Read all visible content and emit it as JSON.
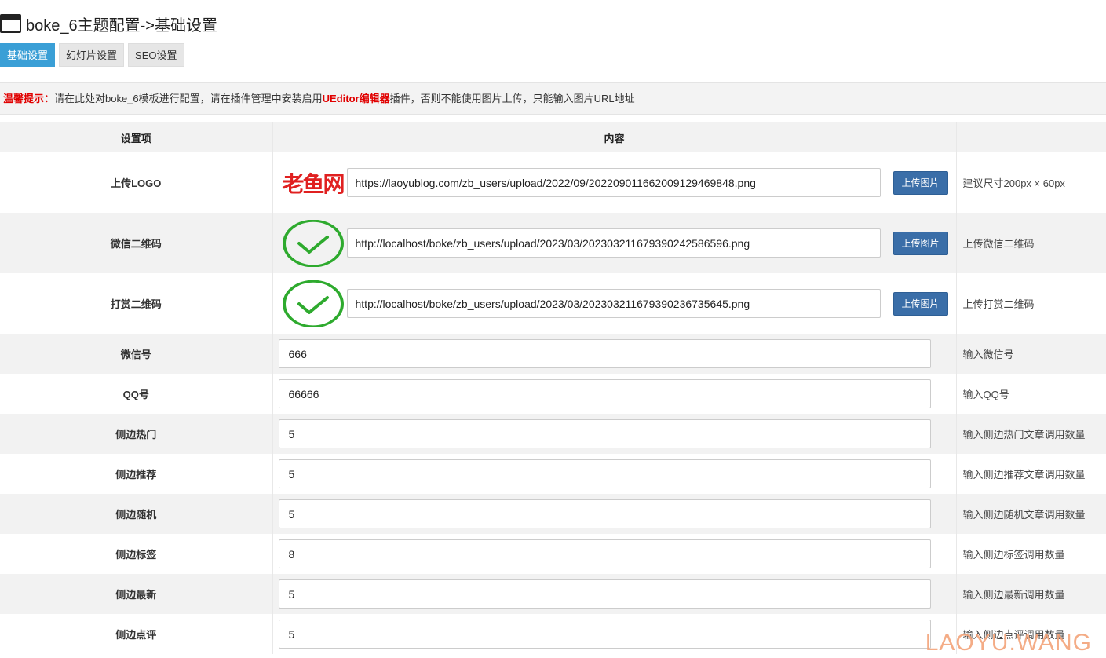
{
  "header": {
    "title": "boke_6主题配置->基础设置",
    "icon": "window-icon"
  },
  "tabs": [
    {
      "label": "基础设置",
      "active": true
    },
    {
      "label": "幻灯片设置",
      "active": false
    },
    {
      "label": "SEO设置",
      "active": false
    }
  ],
  "notice": {
    "prefix": "温馨提示：",
    "text1": "请在此处对boke_6模板进行配置，请在插件管理中安装启用",
    "highlight": "UEditor编辑器",
    "text2": "插件，否则不能使用图片上传，只能输入图片URL地址"
  },
  "table": {
    "headers": {
      "setting": "设置项",
      "content": "内容",
      "hint": ""
    },
    "image_rows": [
      {
        "label": "上传LOGO",
        "thumb": "laoyu-logo",
        "thumb_text": "老鱼网",
        "value": "https://laoyublog.com/zb_users/upload/2022/09/202209011662009129469848.png",
        "button": "上传图片",
        "hint": "建议尺寸200px × 60px"
      },
      {
        "label": "微信二维码",
        "thumb": "green-check-icon",
        "value": "http://localhost/boke/zb_users/upload/2023/03/202303211679390242586596.png",
        "button": "上传图片",
        "hint": "上传微信二维码"
      },
      {
        "label": "打赏二维码",
        "thumb": "green-check-icon",
        "value": "http://localhost/boke/zb_users/upload/2023/03/202303211679390236735645.png",
        "button": "上传图片",
        "hint": "上传打赏二维码"
      }
    ],
    "text_rows": [
      {
        "label": "微信号",
        "value": "666",
        "hint": "输入微信号"
      },
      {
        "label": "QQ号",
        "value": "66666",
        "hint": "输入QQ号"
      },
      {
        "label": "侧边热门",
        "value": "5",
        "hint": "输入侧边热门文章调用数量"
      },
      {
        "label": "侧边推荐",
        "value": "5",
        "hint": "输入侧边推荐文章调用数量"
      },
      {
        "label": "侧边随机",
        "value": "5",
        "hint": "输入侧边随机文章调用数量"
      },
      {
        "label": "侧边标签",
        "value": "8",
        "hint": "输入侧边标签调用数量"
      },
      {
        "label": "侧边最新",
        "value": "5",
        "hint": "输入侧边最新调用数量"
      },
      {
        "label": "侧边点评",
        "value": "5",
        "hint": "输入侧边点评调用数量"
      }
    ]
  },
  "watermark": "LAOYU.WANG",
  "colors": {
    "tab_active": "#3a9fd6",
    "button": "#3a6ea8",
    "notice_red": "#e10000",
    "check_green": "#2eaa2e"
  }
}
